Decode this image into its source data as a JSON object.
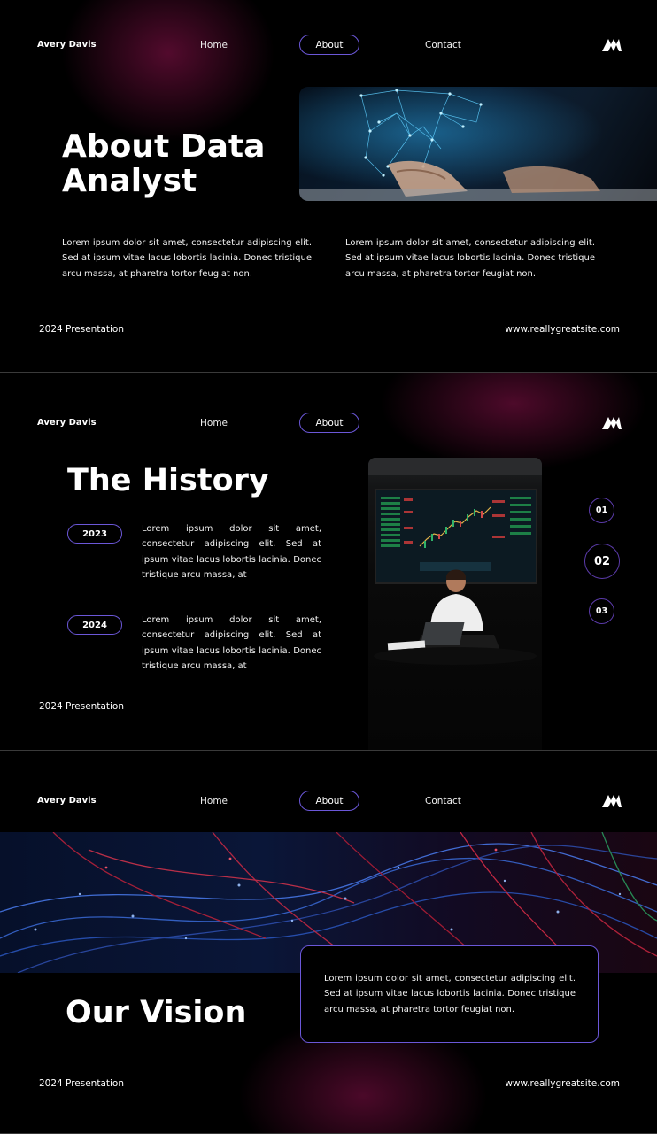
{
  "slide1": {
    "brand": "Avery Davis",
    "nav": {
      "home": "Home",
      "about": "About",
      "contact": "Contact"
    },
    "title_line1": "About Data",
    "title_line2": "Analyst",
    "para_left": "Lorem ipsum dolor sit amet, consectetur adipiscing elit. Sed at ipsum vitae lacus lobortis lacinia. Donec tristique arcu massa, at pharetra tortor feugiat non.",
    "para_right": "Lorem ipsum dolor sit amet, consectetur adipiscing elit. Sed at ipsum vitae lacus lobortis lacinia. Donec tristique arcu massa, at pharetra tortor feugiat non.",
    "footer_left": "2024 Presentation",
    "footer_right": "www.reallygreatsite.com"
  },
  "slide2": {
    "brand": "Avery Davis",
    "nav": {
      "home": "Home",
      "about": "About"
    },
    "title": "The History",
    "timeline": [
      {
        "year": "2023",
        "text": "Lorem ipsum dolor sit amet, consectetur adipiscing elit. Sed at ipsum vitae lacus lobortis lacinia. Donec tristique arcu massa, at"
      },
      {
        "year": "2024",
        "text": "Lorem ipsum dolor sit amet, consectetur adipiscing elit. Sed at ipsum vitae lacus lobortis lacinia. Donec tristique arcu massa, at"
      }
    ],
    "steps": [
      "01",
      "02",
      "03"
    ],
    "footer_left": "2024 Presentation"
  },
  "slide3": {
    "brand": "Avery Davis",
    "nav": {
      "home": "Home",
      "about": "About",
      "contact": "Contact"
    },
    "title": "Our Vision",
    "card_text": "Lorem ipsum dolor sit amet, consectetur adipiscing elit. Sed at ipsum vitae lacus lobortis lacinia. Donec tristique arcu massa, at pharetra tortor feugiat non.",
    "footer_left": "2024 Presentation",
    "footer_right": "www.reallygreatsite.com"
  },
  "icons": {
    "logo": "brand-logo-icon"
  },
  "colors": {
    "accent_border": "#6b57d8",
    "glow": "#5a0f3a",
    "background": "#000000"
  }
}
